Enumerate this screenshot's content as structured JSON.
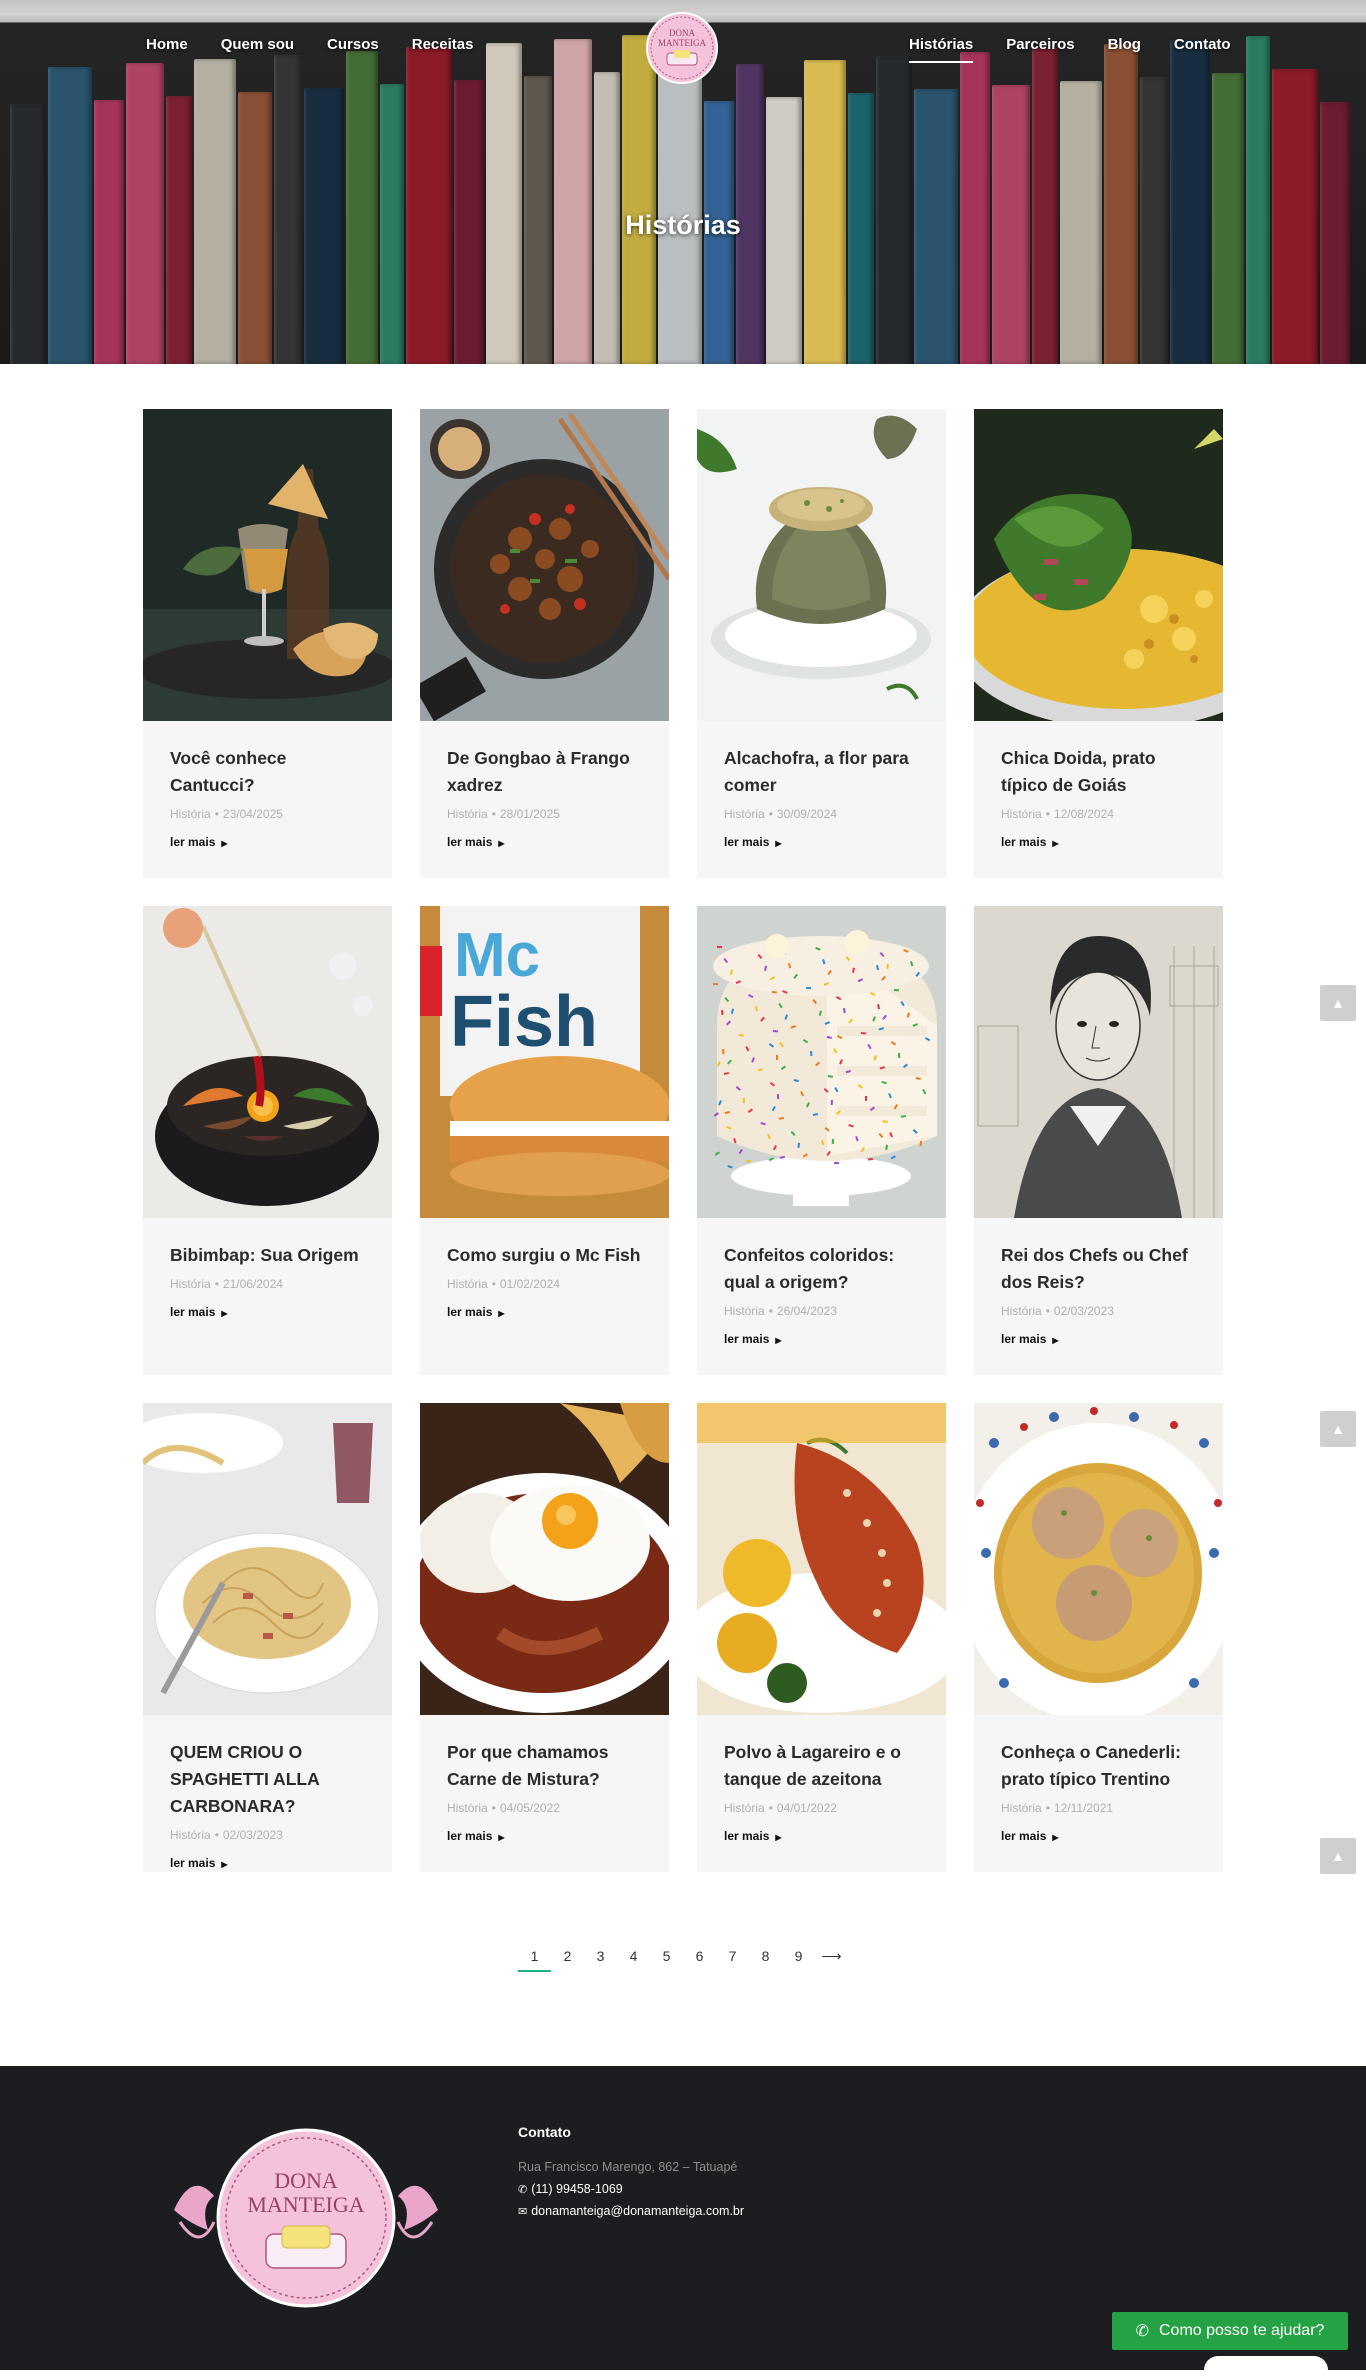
{
  "nav": {
    "left": [
      "Home",
      "Quem sou",
      "Cursos",
      "Receitas"
    ],
    "right": [
      "Histórias",
      "Parceiros",
      "Blog",
      "Contato"
    ],
    "active": "Histórias",
    "logo_text": "DONA MANTEIGA"
  },
  "hero": {
    "title": "Histórias"
  },
  "cards": [
    {
      "title": "Você conhece Cantucci?",
      "category": "História",
      "date": "23/04/2025",
      "more": "ler mais",
      "image": "cantucci-wine"
    },
    {
      "title": "De Gongbao à Frango xadrez",
      "category": "História",
      "date": "28/01/2025",
      "more": "ler mais",
      "image": "chicken-wok"
    },
    {
      "title": "Alcachofra, a flor para comer",
      "category": "História",
      "date": "30/09/2024",
      "more": "ler mais",
      "image": "artichoke"
    },
    {
      "title": "Chica Doida, prato típico de Goiás",
      "category": "História",
      "date": "12/08/2024",
      "more": "ler mais",
      "image": "chica-doida"
    },
    {
      "title": "Bibimbap: Sua Origem",
      "category": "História",
      "date": "21/06/2024",
      "more": "ler mais",
      "image": "bibimbap"
    },
    {
      "title": "Como surgiu o Mc Fish",
      "category": "História",
      "date": "01/02/2024",
      "more": "ler mais",
      "image": "mc-fish"
    },
    {
      "title": "Confeitos coloridos: qual a origem?",
      "category": "História",
      "date": "26/04/2023",
      "more": "ler mais",
      "image": "sprinkle-cake"
    },
    {
      "title": "Rei dos Chefs ou Chef dos Reis?",
      "category": "História",
      "date": "02/03/2023",
      "more": "ler mais",
      "image": "portrait-engraving"
    },
    {
      "title": "QUEM CRIOU O SPAGHETTI ALLA CARBONARA?",
      "category": "História",
      "date": "02/03/2023",
      "more": "ler mais",
      "image": "carbonara"
    },
    {
      "title": "Por que chamamos Carne de Mistura?",
      "category": "História",
      "date": "04/05/2022",
      "more": "ler mais",
      "image": "fried-egg-plate"
    },
    {
      "title": "Polvo à Lagareiro e o tanque de azeitona",
      "category": "História",
      "date": "04/01/2022",
      "more": "ler mais",
      "image": "octopus"
    },
    {
      "title": "Conheça o Canederli: prato típico Trentino",
      "category": "História",
      "date": "12/11/2021",
      "more": "ler mais",
      "image": "canederli-soup"
    }
  ],
  "pagination": {
    "pages": [
      "1",
      "2",
      "3",
      "4",
      "5",
      "6",
      "7",
      "8",
      "9"
    ],
    "current": "1",
    "next": "⟶"
  },
  "footer": {
    "contact_title": "Contato",
    "address": "Rua Francisco Marengo, 862 – Tatuapé",
    "phone": "(11) 99458-1069",
    "email": "donamanteiga@donamanteiga.com.br",
    "logo_text": "DONA MANTEIGA"
  },
  "whatsapp": {
    "label": "Como posso te ajudar?"
  },
  "colors": {
    "accent": "#1bb28b",
    "footer_bg": "#1c1d21",
    "card_bg": "#f6f6f6",
    "whatsapp": "#25a244",
    "logo_pink": "#f1b9d4"
  },
  "icons": {
    "scroll_top": "arrow-up-icon",
    "phone": "whatsapp-icon",
    "email": "envelope-icon",
    "more": "caret-right-icon"
  }
}
